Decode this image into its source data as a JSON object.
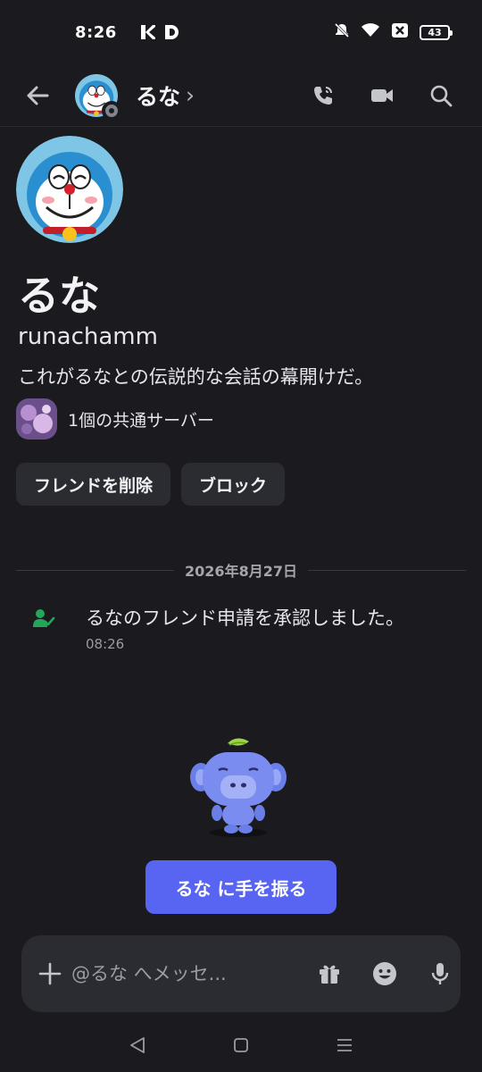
{
  "status_bar": {
    "time": "8:26",
    "battery": "43",
    "icons": [
      "k-app-icon",
      "d-app-icon",
      "mute-icon",
      "wifi-icon",
      "close-box-icon",
      "battery-icon"
    ]
  },
  "header": {
    "name": "るな",
    "chevron": "›",
    "actions": [
      "voice-call-icon",
      "video-call-icon",
      "search-icon"
    ]
  },
  "profile": {
    "display_name": "るな",
    "username": "runachamm",
    "intro": "これがるなとの伝説的な会話の幕開けだ。",
    "mutual_servers": "1個の共通サーバー",
    "remove_friend": "フレンドを削除",
    "block": "ブロック"
  },
  "timeline": {
    "date": "2026年8月27日",
    "system_message": "るなのフレンド申請を承認しました。",
    "system_time": "08:26"
  },
  "wave_button": "るな に手を振る",
  "composer": {
    "placeholder": "@るな へメッセ..."
  },
  "colors": {
    "background": "#1b1b1f",
    "surface": "#2b2c31",
    "accent": "#5865f2",
    "success": "#23a55a",
    "muted_text": "#9a9ca3"
  }
}
